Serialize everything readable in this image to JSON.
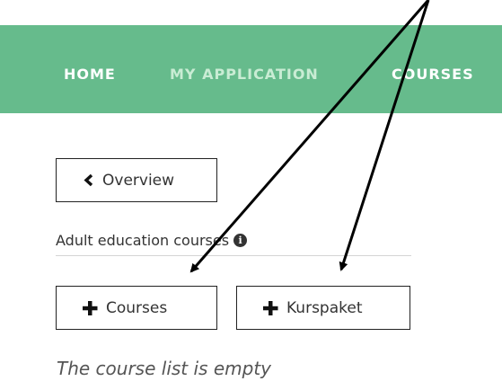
{
  "nav": {
    "home": "HOME",
    "my_application": "MY APPLICATION",
    "courses": "COURSES"
  },
  "overview_button": {
    "label": "Overview",
    "icon": "chevron-left-icon"
  },
  "section": {
    "label": "Adult education courses",
    "icon": "info-icon",
    "icon_glyph": "i"
  },
  "add_buttons": {
    "courses_label": "Courses",
    "kurspaket_label": "Kurspaket",
    "icon": "plus-icon"
  },
  "empty_message": "The course list is empty",
  "colors": {
    "navbar": "#66bb8c",
    "nav_active": "#ffffff",
    "nav_muted": "#c9ecd4"
  }
}
